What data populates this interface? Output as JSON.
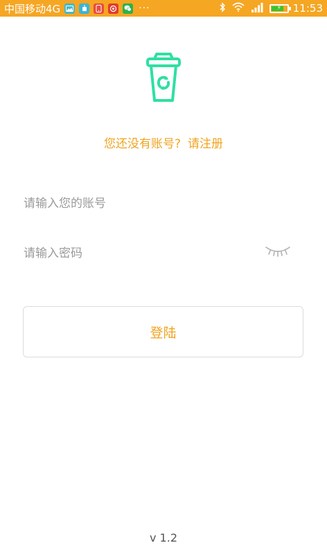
{
  "status_bar": {
    "carrier": "中国移动4G",
    "notification_icons": [
      {
        "icon": "image-app-icon",
        "color": "#43b8c9"
      },
      {
        "icon": "robot-app-icon",
        "color": "#3cb4d6"
      },
      {
        "icon": "phone-app-icon",
        "color": "#e84c3d"
      },
      {
        "icon": "weibo-app-icon",
        "color": "#e23b2e"
      },
      {
        "icon": "wechat-app-icon",
        "color": "#2bb24c"
      }
    ],
    "more": "···",
    "time": "11:53",
    "battery_color": "#33c733",
    "background_color": "#f5a623"
  },
  "logo": {
    "icon": "recycle-cup-icon",
    "color": "#2ee0a1"
  },
  "register": {
    "prompt": "您还没有账号?",
    "link": "请注册"
  },
  "form": {
    "account_placeholder": "请输入您的账号",
    "password_placeholder": "请输入密码",
    "password_toggle_icon": "eye-closed-icon"
  },
  "login_button": {
    "label": "登陆"
  },
  "version": "v 1.2",
  "accent_color": "#f0a320"
}
